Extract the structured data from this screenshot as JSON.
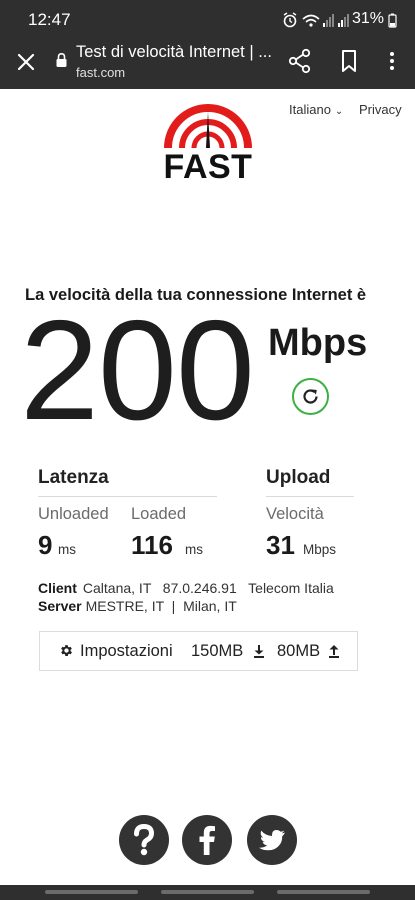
{
  "status_bar": {
    "time": "12:47",
    "battery_text": "31%"
  },
  "browser": {
    "title": "Test di velocità Internet | ...",
    "url": "fast.com"
  },
  "header": {
    "logo_text": "FAST",
    "language": "Italiano",
    "privacy": "Privacy",
    "accent_color": "#e21b1b"
  },
  "speed": {
    "caption": "La velocità della tua connessione Internet è",
    "value": "200",
    "units": "Mbps",
    "refresh_color": "#3cb043"
  },
  "latency": {
    "heading": "Latenza",
    "unloaded_label": "Unloaded",
    "unloaded_value": "9",
    "unloaded_unit": "ms",
    "loaded_label": "Loaded",
    "loaded_value": "116",
    "loaded_unit": "ms"
  },
  "upload": {
    "heading": "Upload",
    "speed_label": "Velocità",
    "speed_value": "31",
    "speed_unit": "Mbps"
  },
  "connection": {
    "client_label": "Client",
    "client_value": "Caltana, IT   87.0.246.91   Telecom Italia",
    "server_label": "Server",
    "server_value": "MESTRE, IT  |  Milan, IT"
  },
  "settings": {
    "label": "Impostazioni",
    "download_size": "150MB",
    "upload_size": "80MB"
  },
  "social": {
    "icons": [
      "question-icon",
      "facebook-icon",
      "twitter-icon"
    ]
  }
}
